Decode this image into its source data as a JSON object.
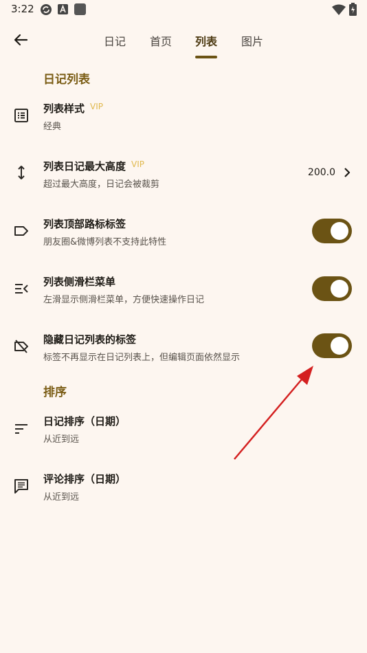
{
  "status_bar": {
    "time": "3:22",
    "icons": [
      "sync-icon",
      "a-badge-icon",
      "square-icon",
      "wifi-icon",
      "battery-icon"
    ]
  },
  "app_bar": {
    "tabs": [
      {
        "label": "日记",
        "active": false
      },
      {
        "label": "首页",
        "active": false
      },
      {
        "label": "列表",
        "active": true
      },
      {
        "label": "图片",
        "active": false
      }
    ]
  },
  "colors": {
    "accent": "#6b5314",
    "section_title": "#7a5c14",
    "vip": "#e0b94e",
    "background": "#fdf6f0",
    "annotation_arrow": "#d42020"
  },
  "sections": {
    "list": {
      "title": "日记列表",
      "items": [
        {
          "title": "列表样式",
          "vip": "VIP",
          "subtitle": "经典",
          "icon": "list-style-icon"
        },
        {
          "title": "列表日记最大高度",
          "vip": "VIP",
          "subtitle": "超过最大高度，日记会被裁剪",
          "value": "200.0",
          "icon": "vertical-resize-icon"
        },
        {
          "title": "列表顶部路标标签",
          "subtitle": "朋友圈&微博列表不支持此特性",
          "toggle": true,
          "icon": "label-icon"
        },
        {
          "title": "列表侧滑栏菜单",
          "subtitle": "左滑显示侧滑栏菜单，方便快速操作日记",
          "toggle": true,
          "icon": "menu-open-icon"
        },
        {
          "title": "隐藏日记列表的标签",
          "subtitle": "标签不再显示在日记列表上，但编辑页面依然显示",
          "toggle": true,
          "icon": "label-off-icon"
        }
      ]
    },
    "sort": {
      "title": "排序",
      "items": [
        {
          "title": "日记排序（日期）",
          "subtitle": "从近到远",
          "icon": "sort-icon"
        },
        {
          "title": "评论排序（日期）",
          "subtitle": "从近到远",
          "icon": "comment-icon"
        }
      ]
    }
  }
}
